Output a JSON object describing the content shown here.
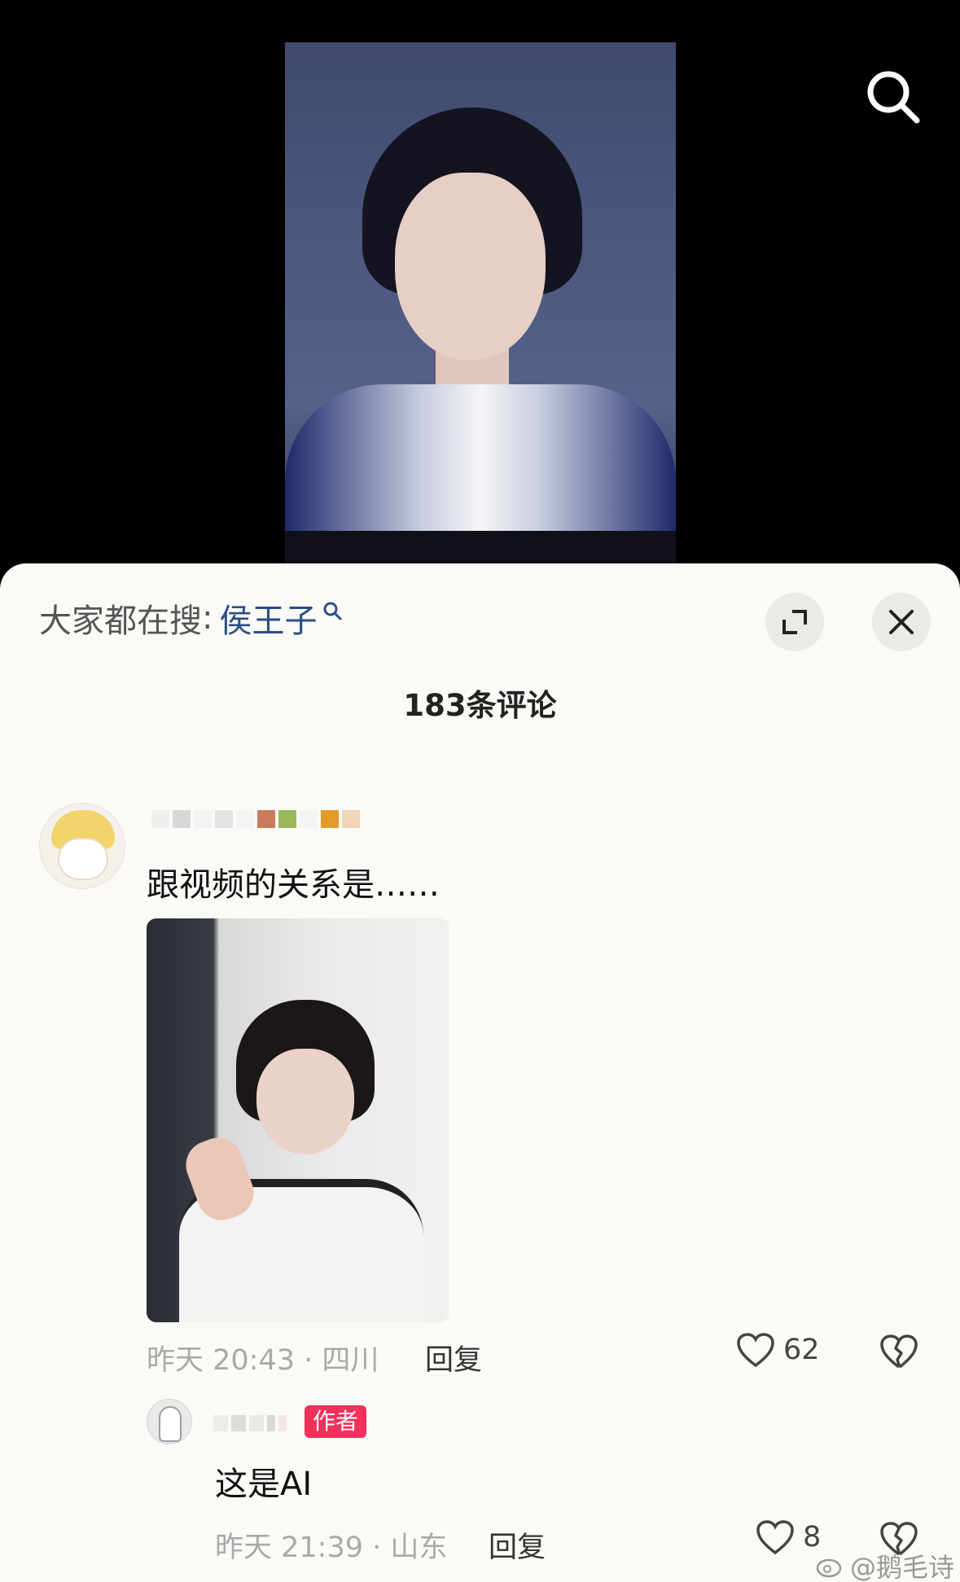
{
  "video": {
    "search_icon": "search-icon"
  },
  "sheet": {
    "trending_label": "大家都在搜",
    "trending_colon": ":",
    "trending_term": "侯王子",
    "trending_icon": "search-small-icon",
    "expand_icon": "expand-icon",
    "close_icon": "close-icon",
    "comment_count_title": "183条评论"
  },
  "comments": [
    {
      "text": "跟视频的关系是……",
      "time_location": "昨天 20:43 · 四川",
      "reply_label": "回复",
      "likes": "62",
      "has_image": true
    }
  ],
  "replies": [
    {
      "badge": "作者",
      "text": "这是AI",
      "time_location": "昨天 21:39 · 山东",
      "reply_label": "回复",
      "likes": "8"
    }
  ],
  "watermark": {
    "text": "@鹅毛诗"
  },
  "colors": {
    "link_blue": "#2a4f86",
    "author_badge": "#f0315a",
    "meta_gray": "#a9a9a9"
  }
}
